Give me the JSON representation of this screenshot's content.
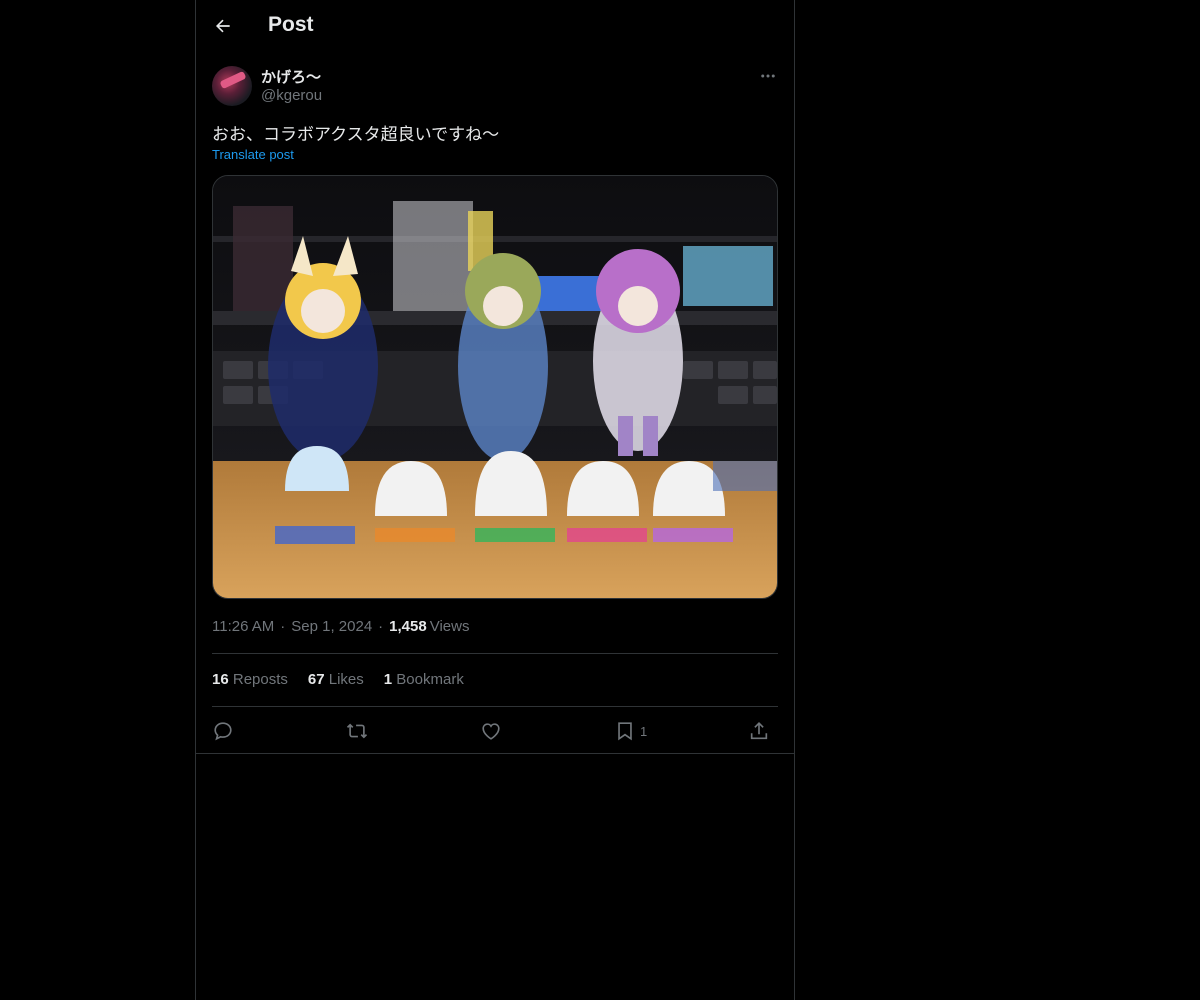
{
  "header": {
    "title": "Post"
  },
  "author": {
    "display_name": "かげろ〜",
    "handle": "@kgerou"
  },
  "post": {
    "text": "おお、コラボアクスタ超良いですね〜",
    "translate_label": "Translate post",
    "time": "11:26 AM",
    "date": "Sep 1, 2024",
    "views_count": "1,458",
    "views_label": "Views",
    "separator": "·"
  },
  "stats": {
    "reposts_count": "16",
    "reposts_label": "Reposts",
    "likes_count": "67",
    "likes_label": "Likes",
    "bookmarks_count": "1",
    "bookmarks_label": "Bookmark"
  },
  "actions": {
    "bookmark_count": "1",
    "icons": [
      "reply-icon",
      "repost-icon",
      "like-icon",
      "bookmark-icon",
      "share-icon"
    ]
  },
  "colors": {
    "background": "#000000",
    "text": "#e7e9ea",
    "muted": "#71767b",
    "link": "#1d9bf0",
    "border": "#2f3336"
  }
}
